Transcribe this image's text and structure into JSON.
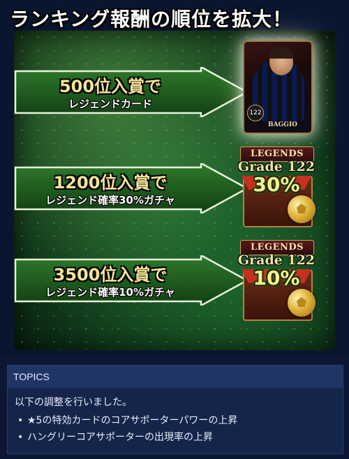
{
  "banner": {
    "title": "ランキング報酬の順位を拡大！",
    "rewards": [
      {
        "rank": "500位入賞で",
        "description": "レジェンドカード",
        "card_rating": "122",
        "card_name": "BAGGIO"
      },
      {
        "rank": "1200位入賞で",
        "description": "レジェンド確率30%ガチャ",
        "legend_label": "LEGENDS",
        "grade": "Grade 122",
        "percent": "30%"
      },
      {
        "rank": "3500位入賞で",
        "description": "レジェンド確率10%ガチャ",
        "legend_label": "LEGENDS",
        "grade": "Grade 122",
        "percent": "10%"
      }
    ],
    "colors": {
      "field": "#1f5a2a",
      "rank_text": "#f5e39a",
      "percent_text": "#f7f08a"
    }
  },
  "topics": {
    "header": "TOPICS",
    "intro": "以下の調整を行いました。",
    "items": [
      "★5の特効カードのコアサポーターパワーの上昇",
      "ハングリーコアサポーターの出現率の上昇"
    ],
    "bullet": "•"
  }
}
